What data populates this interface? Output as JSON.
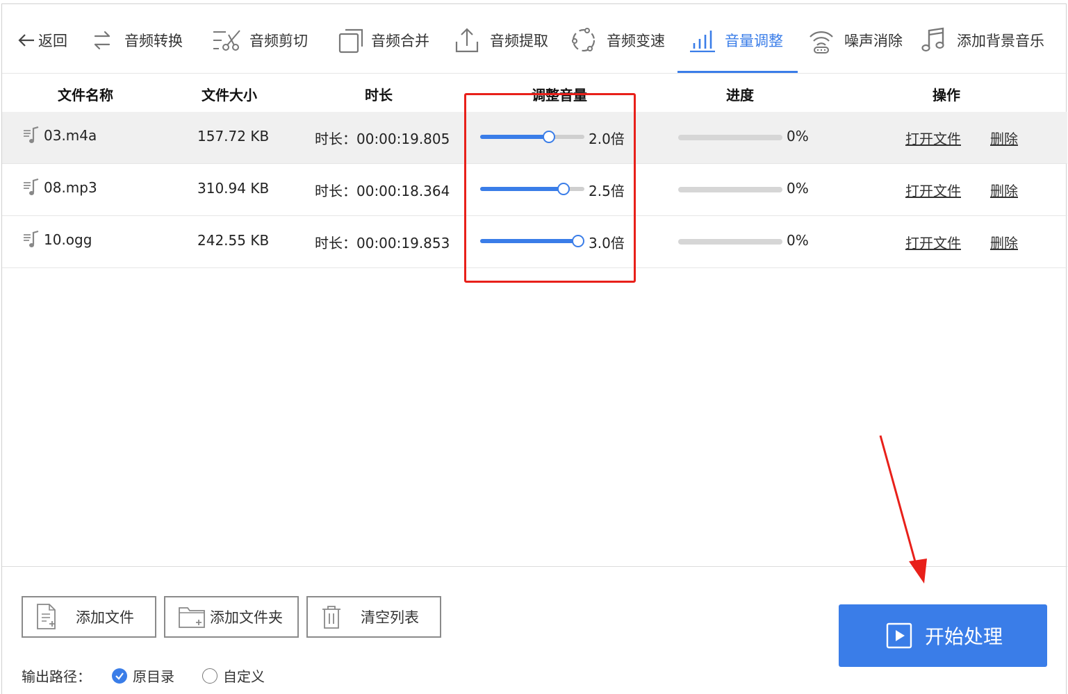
{
  "toolbar": {
    "items": [
      {
        "label": "返回",
        "icon": "back-arrow-icon"
      },
      {
        "label": "音频转换",
        "icon": "convert-icon"
      },
      {
        "label": "音频剪切",
        "icon": "scissors-icon"
      },
      {
        "label": "音频合并",
        "icon": "merge-icon"
      },
      {
        "label": "音频提取",
        "icon": "extract-icon"
      },
      {
        "label": "音频变速",
        "icon": "speed-icon"
      },
      {
        "label": "音量调整",
        "icon": "volume-bars-icon",
        "active": true
      },
      {
        "label": "噪声消除",
        "icon": "noise-icon"
      },
      {
        "label": "添加背景音乐",
        "icon": "music-note-icon"
      }
    ]
  },
  "table": {
    "headers": [
      "文件名称",
      "文件大小",
      "时长",
      "调整音量",
      "进度",
      "操作"
    ],
    "rows": [
      {
        "name": "03.m4a",
        "size": "157.72 KB",
        "duration": "时长：00:00:19.805",
        "volume_multiplier": "2.0倍",
        "slider_level": 0.66,
        "progress": "0%",
        "progress_value": 0,
        "open": "打开文件",
        "delete": "删除",
        "selected": true
      },
      {
        "name": "08.mp3",
        "size": "310.94 KB",
        "duration": "时长：00:00:18.364",
        "volume_multiplier": "2.5倍",
        "slider_level": 0.8,
        "progress": "0%",
        "progress_value": 0,
        "open": "打开文件",
        "delete": "删除",
        "selected": false
      },
      {
        "name": "10.ogg",
        "size": "242.55 KB",
        "duration": "时长：00:00:19.853",
        "volume_multiplier": "3.0倍",
        "slider_level": 0.94,
        "progress": "0%",
        "progress_value": 0,
        "open": "打开文件",
        "delete": "删除",
        "selected": false
      }
    ]
  },
  "footer": {
    "add_file": "添加文件",
    "add_folder": "添加文件夹",
    "clear_list": "清空列表",
    "start": "开始处理",
    "output_label": "输出路径：",
    "option_original": "原目录",
    "option_custom": "自定义",
    "selected_option": "原目录"
  },
  "colors": {
    "accent": "#3a7de8",
    "annotation_red": "#e8201a"
  }
}
